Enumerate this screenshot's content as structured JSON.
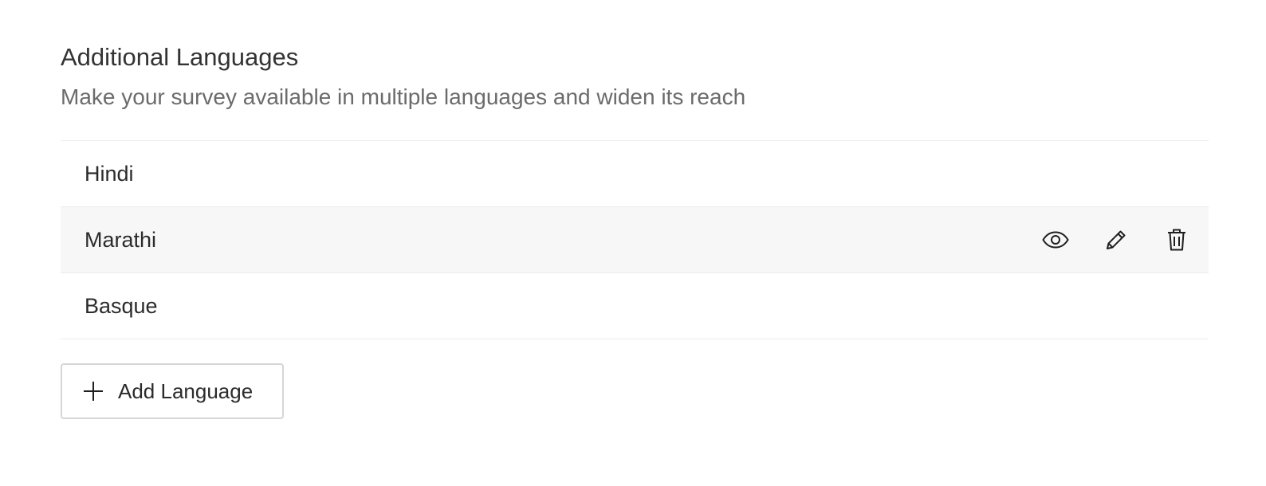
{
  "section": {
    "title": "Additional Languages",
    "subtitle": "Make your survey available in multiple languages and widen its reach"
  },
  "languages": [
    {
      "name": "Hindi"
    },
    {
      "name": "Marathi"
    },
    {
      "name": "Basque"
    }
  ],
  "row_actions": {
    "preview_icon": "eye-icon",
    "edit_icon": "pencil-icon",
    "delete_icon": "trash-icon"
  },
  "add_button": {
    "icon": "plus-icon",
    "label": "Add Language"
  },
  "colors": {
    "hover_row_bg": "#f7f7f7",
    "divider": "#ececec",
    "subtitle_text": "#6b6b6b"
  }
}
